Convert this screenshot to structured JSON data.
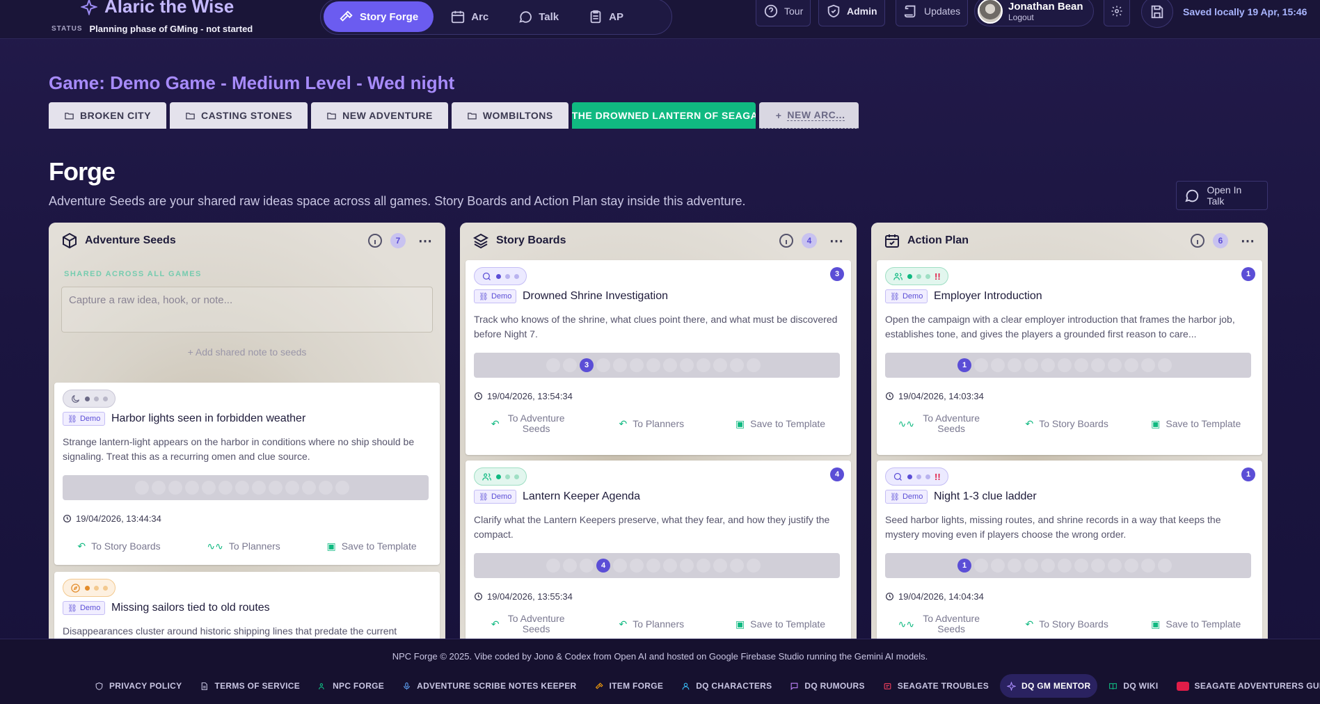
{
  "header": {
    "app_title": "Alaric the Wise",
    "status_label": "STATUS",
    "status_value": "Planning phase of GMing - not started",
    "nav": [
      {
        "label": "Story Forge",
        "icon": "hammer-icon",
        "active": true
      },
      {
        "label": "Arc",
        "icon": "calendar-icon"
      },
      {
        "label": "Talk",
        "icon": "chat-icon"
      },
      {
        "label": "AP",
        "icon": "clipboard-icon"
      }
    ],
    "tour": "Tour",
    "admin": "Admin",
    "updates": "Updates",
    "user_name": "Jonathan Bean",
    "logout": "Logout",
    "saved": "Saved locally 19 Apr, 15:46"
  },
  "game": {
    "title": "Game: Demo Game - Medium Level - Wed night",
    "tabs": [
      "BROKEN CITY",
      "CASTING STONES",
      "NEW ADVENTURE",
      "WOMBILTONS",
      "THE DROWNED LANTERN OF SEAGATE"
    ],
    "new_arc": "NEW ARC...",
    "active_tab_color": "#10b981"
  },
  "forge": {
    "title": "Forge",
    "description": "Adventure Seeds are your shared raw ideas space across all games. Story Boards and Action Plan stay inside this adventure.",
    "open_talk": "Open In Talk"
  },
  "seeds": {
    "title": "Adventure Seeds",
    "count": "7",
    "shared_label": "SHARED ACROSS ALL GAMES",
    "capture_placeholder": "Capture a raw idea, hook, or note...",
    "add_note": "Add shared note to seeds",
    "cards": [
      {
        "tag": "Demo",
        "title": "Harbor lights seen in forbidden weather",
        "desc": "Strange lantern-light appears on the harbor in conditions where no ship should be signaling. Treat this as a recurring omen and clue source.",
        "timestamp": "19/04/2026, 13:44:34",
        "act1": "To Story Boards",
        "act2": "To Planners",
        "act3": "Save to Template"
      },
      {
        "tag": "Demo",
        "title": "Missing sailors tied to old routes",
        "desc": "Disappearances cluster around historic shipping lines that predate the current"
      }
    ]
  },
  "boards": {
    "title": "Story Boards",
    "count": "4",
    "cards": [
      {
        "num": "3",
        "tag": "Demo",
        "title": "Drowned Shrine Investigation",
        "desc": "Track who knows of the shrine, what clues point there, and what must be discovered before Night 7.",
        "night": "3",
        "timestamp": "19/04/2026, 13:54:34",
        "act1": "To Adventure Seeds",
        "act2": "To Planners",
        "act3": "Save to Template"
      },
      {
        "num": "4",
        "tag": "Demo",
        "title": "Lantern Keeper Agenda",
        "desc": "Clarify what the Lantern Keepers preserve, what they fear, and how they justify the compact.",
        "night": "4",
        "timestamp": "19/04/2026, 13:55:34",
        "act1": "To Adventure Seeds",
        "act2": "To Planners",
        "act3": "Save to Template"
      }
    ]
  },
  "plan": {
    "title": "Action Plan",
    "count": "6",
    "cards": [
      {
        "num": "1",
        "tag": "Demo",
        "title": "Employer Introduction",
        "desc": "Open the campaign with a clear employer introduction that frames the harbor job, establishes tone, and gives the players a grounded first reason to care...",
        "night": "1",
        "priority": "!!",
        "timestamp": "19/04/2026, 14:03:34",
        "act1": "To Adventure Seeds",
        "act2": "To Story Boards",
        "act3": "Save to Template"
      },
      {
        "num": "1",
        "tag": "Demo",
        "title": "Night 1-3 clue ladder",
        "desc": "Seed harbor lights, missing routes, and shrine records in a way that keeps the mystery moving even if players choose the wrong order.",
        "night": "1",
        "priority": "!!",
        "timestamp": "19/04/2026, 14:04:34",
        "act1": "To Adventure Seeds",
        "act2": "To Story Boards",
        "act3": "Save to Template"
      }
    ]
  },
  "footer": {
    "copyright": "NPC Forge © 2025. Vibe coded by Jono & Codex from Open AI and hosted on Google Firebase Studio running the Gemini AI models.",
    "links": [
      "PRIVACY POLICY",
      "TERMS OF SERVICE",
      "NPC FORGE",
      "ADVENTURE SCRIBE NOTES KEEPER",
      "ITEM FORGE",
      "DQ CHARACTERS",
      "DQ RUMOURS",
      "SEAGATE TROUBLES",
      "DQ GM MENTOR",
      "DQ WIKI",
      "SEAGATE ADVENTURERS GUILD YOUTUBE"
    ]
  }
}
